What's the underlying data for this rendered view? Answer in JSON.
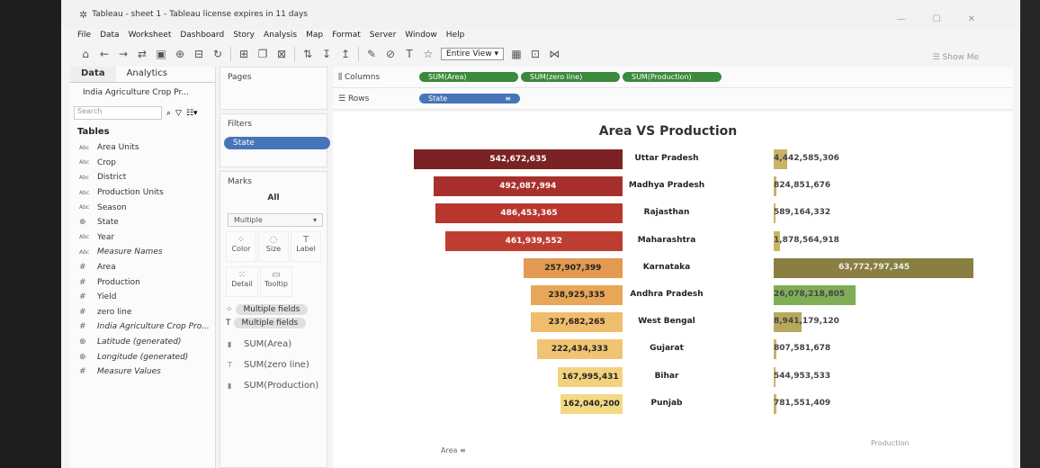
{
  "window": {
    "title": "Tableau - sheet 1 - Tableau license expires in 11 days"
  },
  "menu": [
    "File",
    "Data",
    "Worksheet",
    "Dashboard",
    "Story",
    "Analysis",
    "Map",
    "Format",
    "Server",
    "Window",
    "Help"
  ],
  "toolbar": {
    "fit": "Entire View",
    "show_me": "Show Me"
  },
  "datapane": {
    "tab_data": "Data",
    "tab_analytics": "Analytics",
    "datasource": "India Agriculture Crop Pr...",
    "search_placeholder": "Search",
    "tables_header": "Tables",
    "fields": [
      {
        "type": "Abc",
        "name": "Area Units",
        "italic": false
      },
      {
        "type": "Abc",
        "name": "Crop",
        "italic": false
      },
      {
        "type": "Abc",
        "name": "District",
        "italic": false
      },
      {
        "type": "Abc",
        "name": "Production Units",
        "italic": false
      },
      {
        "type": "Abc",
        "name": "Season",
        "italic": false
      },
      {
        "type": "globe",
        "name": "State",
        "italic": false
      },
      {
        "type": "Abc",
        "name": "Year",
        "italic": false
      },
      {
        "type": "Abc",
        "name": "Measure Names",
        "italic": true
      },
      {
        "type": "#",
        "name": "Area",
        "italic": false
      },
      {
        "type": "#",
        "name": "Production",
        "italic": false
      },
      {
        "type": "#",
        "name": "Yield",
        "italic": false
      },
      {
        "type": "#",
        "name": "zero line",
        "italic": false
      },
      {
        "type": "#",
        "name": "India Agriculture Crop Pro...",
        "italic": true
      },
      {
        "type": "globe",
        "name": "Latitude (generated)",
        "italic": true
      },
      {
        "type": "globe",
        "name": "Longitude (generated)",
        "italic": true
      },
      {
        "type": "#",
        "name": "Measure Values",
        "italic": true
      }
    ]
  },
  "cards": {
    "pages": "Pages",
    "filters": "Filters",
    "filter_pill": "State",
    "marks": "Marks",
    "marks_all": "All",
    "mark_type": "Multiple",
    "mark_buttons": [
      "Color",
      "Size",
      "Label",
      "Detail",
      "Tooltip"
    ],
    "multiple_fields_1": "Multiple fields",
    "multiple_fields_2": "Multiple fields",
    "mark_rows": [
      "SUM(Area)",
      "SUM(zero line)",
      "SUM(Production)"
    ]
  },
  "shelves": {
    "columns_label": "Columns",
    "rows_label": "Rows",
    "columns": [
      "SUM(Area)",
      "SUM(zero line)",
      "SUM(Production)"
    ],
    "rows": [
      "State"
    ]
  },
  "chart_data": {
    "type": "bar",
    "title": "Area VS Production",
    "xlabel_left": "Area",
    "xlabel_right": "Production",
    "categories": [
      "Uttar Pradesh",
      "Madhya Pradesh",
      "Rajasthan",
      "Maharashtra",
      "Karnataka",
      "Andhra Pradesh",
      "West Bengal",
      "Gujarat",
      "Bihar",
      "Punjab"
    ],
    "series": [
      {
        "name": "Area",
        "values": [
          542672635,
          492087994,
          486453365,
          461939552,
          257907399,
          238925335,
          237682265,
          222434333,
          167995431,
          162040200
        ],
        "labels": [
          "542,672,635",
          "492,087,994",
          "486,453,365",
          "461,939,552",
          "257,907,399",
          "238,925,335",
          "237,682,265",
          "222,434,333",
          "167,995,431",
          "162,040,200"
        ]
      },
      {
        "name": "Production",
        "values": [
          4442585306,
          824851676,
          589164332,
          1878564918,
          63772797345,
          26078218805,
          8941179120,
          807581678,
          544953533,
          781551409
        ],
        "labels": [
          "4,442,585,306",
          "824,851,676",
          "589,164,332",
          "1,878,564,918",
          "63,772,797,345",
          "26,078,218,805",
          "8,941,179,120",
          "807,581,678",
          "544,953,533",
          "781,551,409"
        ]
      }
    ],
    "area_colors": [
      "#7a2224",
      "#a8302c",
      "#b8362e",
      "#bd3e30",
      "#e39a52",
      "#e8a658",
      "#efbd6c",
      "#f0c472",
      "#f2d27e",
      "#f4d985"
    ],
    "production_colors": [
      "#c8b466",
      "#c8b466",
      "#c8b466",
      "#c8b466",
      "#8a7f42",
      "#7fae57",
      "#b8a85c",
      "#c8b466",
      "#c8b466",
      "#c8b466"
    ]
  }
}
